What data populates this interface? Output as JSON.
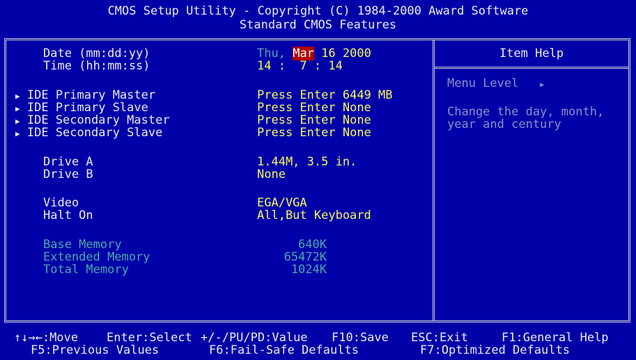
{
  "header": {
    "line1": "CMOS Setup Utility - Copyright (C) 1984-2000 Award Software",
    "line2": "Standard CMOS Features"
  },
  "fields": {
    "date_label": "Date (mm:dd:yy)",
    "date_day": "Thu,",
    "date_month": "Mar",
    "date_rest": "16 2000",
    "time_label": "Time (hh:mm:ss)",
    "time_value": "14 :  7 : 14",
    "ide_items": [
      {
        "label": "IDE Primary Master",
        "action": "Press Enter",
        "value": "6449 MB"
      },
      {
        "label": "IDE Primary Slave",
        "action": "Press Enter",
        "value": "None"
      },
      {
        "label": "IDE Secondary Master",
        "action": "Press Enter",
        "value": "None"
      },
      {
        "label": "IDE Secondary Slave",
        "action": "Press Enter",
        "value": "None"
      }
    ],
    "drive_a_label": "Drive A",
    "drive_a_value": "1.44M, 3.5 in.",
    "drive_b_label": "Drive B",
    "drive_b_value": "None",
    "video_label": "Video",
    "video_value": "EGA/VGA",
    "halt_label": "Halt On",
    "halt_value": "All,But Keyboard",
    "base_mem_label": "Base Memory",
    "base_mem_value": "640K",
    "ext_mem_label": "Extended Memory",
    "ext_mem_value": "65472K",
    "total_mem_label": "Total Memory",
    "total_mem_value": "1024K"
  },
  "help": {
    "title": "Item Help",
    "menu_level": "Menu Level",
    "text_line1": "Change the day, month,",
    "text_line2": "year and century"
  },
  "footer": {
    "move": "↑↓→←:Move",
    "select": "Enter:Select",
    "value": "+/-/PU/PD:Value",
    "save": "F10:Save",
    "exit": "ESC:Exit",
    "help": "F1:General Help",
    "prev": "F5:Previous Values",
    "failsafe": "F6:Fail-Safe Defaults",
    "optimized": "F7:Optimized Defaults"
  },
  "icons": {
    "submenu": "submenu-arrow-icon",
    "menu_level": "menu-level-arrow-icon"
  },
  "colors": {
    "background": "#0000a8",
    "value_text": "#f8f85c",
    "label_text": "#ececec",
    "disabled_text": "#4ca8a8",
    "highlight": "#b00000",
    "help_text": "#8e8ec6"
  }
}
